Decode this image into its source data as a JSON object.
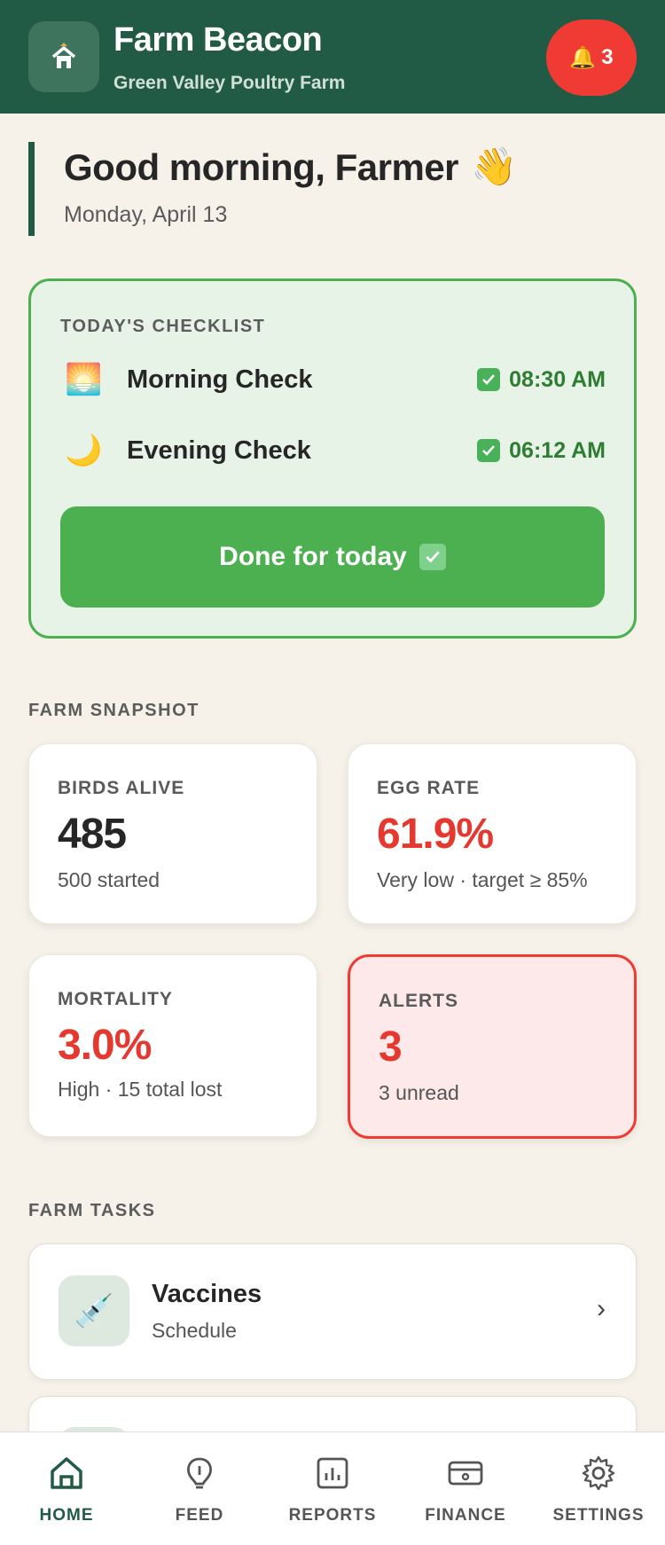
{
  "header": {
    "app_title": "Farm Beacon",
    "farm_name": "Green Valley Poultry Farm",
    "notification_count": "3"
  },
  "greeting": {
    "text": "Good morning, Farmer",
    "emoji": "👋",
    "date": "Monday, April 13"
  },
  "checklist": {
    "label": "TODAY'S CHECKLIST",
    "items": [
      {
        "emoji": "🌅",
        "name": "Morning Check",
        "time": "08:30 AM",
        "done": true
      },
      {
        "emoji": "🌙",
        "name": "Evening Check",
        "time": "06:12 AM",
        "done": true
      }
    ],
    "done_button": "Done for today"
  },
  "snapshot": {
    "label": "FARM SNAPSHOT",
    "cards": [
      {
        "title": "BIRDS ALIVE",
        "value": "485",
        "sub": "500 started",
        "value_color": "#262626"
      },
      {
        "title": "EGG RATE",
        "value": "61.9%",
        "sub": "Very low · target ≥ 85%",
        "value_color": "#e53930"
      },
      {
        "title": "MORTALITY",
        "value": "3.0%",
        "sub": "High · 15 total lost",
        "value_color": "#e53930"
      },
      {
        "title": "ALERTS",
        "value": "3",
        "sub": "3 unread",
        "value_color": "#e53930"
      }
    ]
  },
  "tasks": {
    "label": "FARM TASKS",
    "items": [
      {
        "icon": "syringe-icon",
        "emoji": "💉",
        "title": "Vaccines",
        "sub": "Schedule"
      }
    ]
  },
  "nav": {
    "items": [
      {
        "label": "HOME",
        "icon": "home-icon",
        "active": true
      },
      {
        "label": "FEED",
        "icon": "feed-icon",
        "active": false
      },
      {
        "label": "REPORTS",
        "icon": "reports-icon",
        "active": false
      },
      {
        "label": "FINANCE",
        "icon": "finance-icon",
        "active": false
      },
      {
        "label": "SETTINGS",
        "icon": "gear-icon",
        "active": false
      }
    ]
  },
  "colors": {
    "brand": "#215b45",
    "accent_green": "#4caf50",
    "alert_red": "#ef3b33"
  }
}
